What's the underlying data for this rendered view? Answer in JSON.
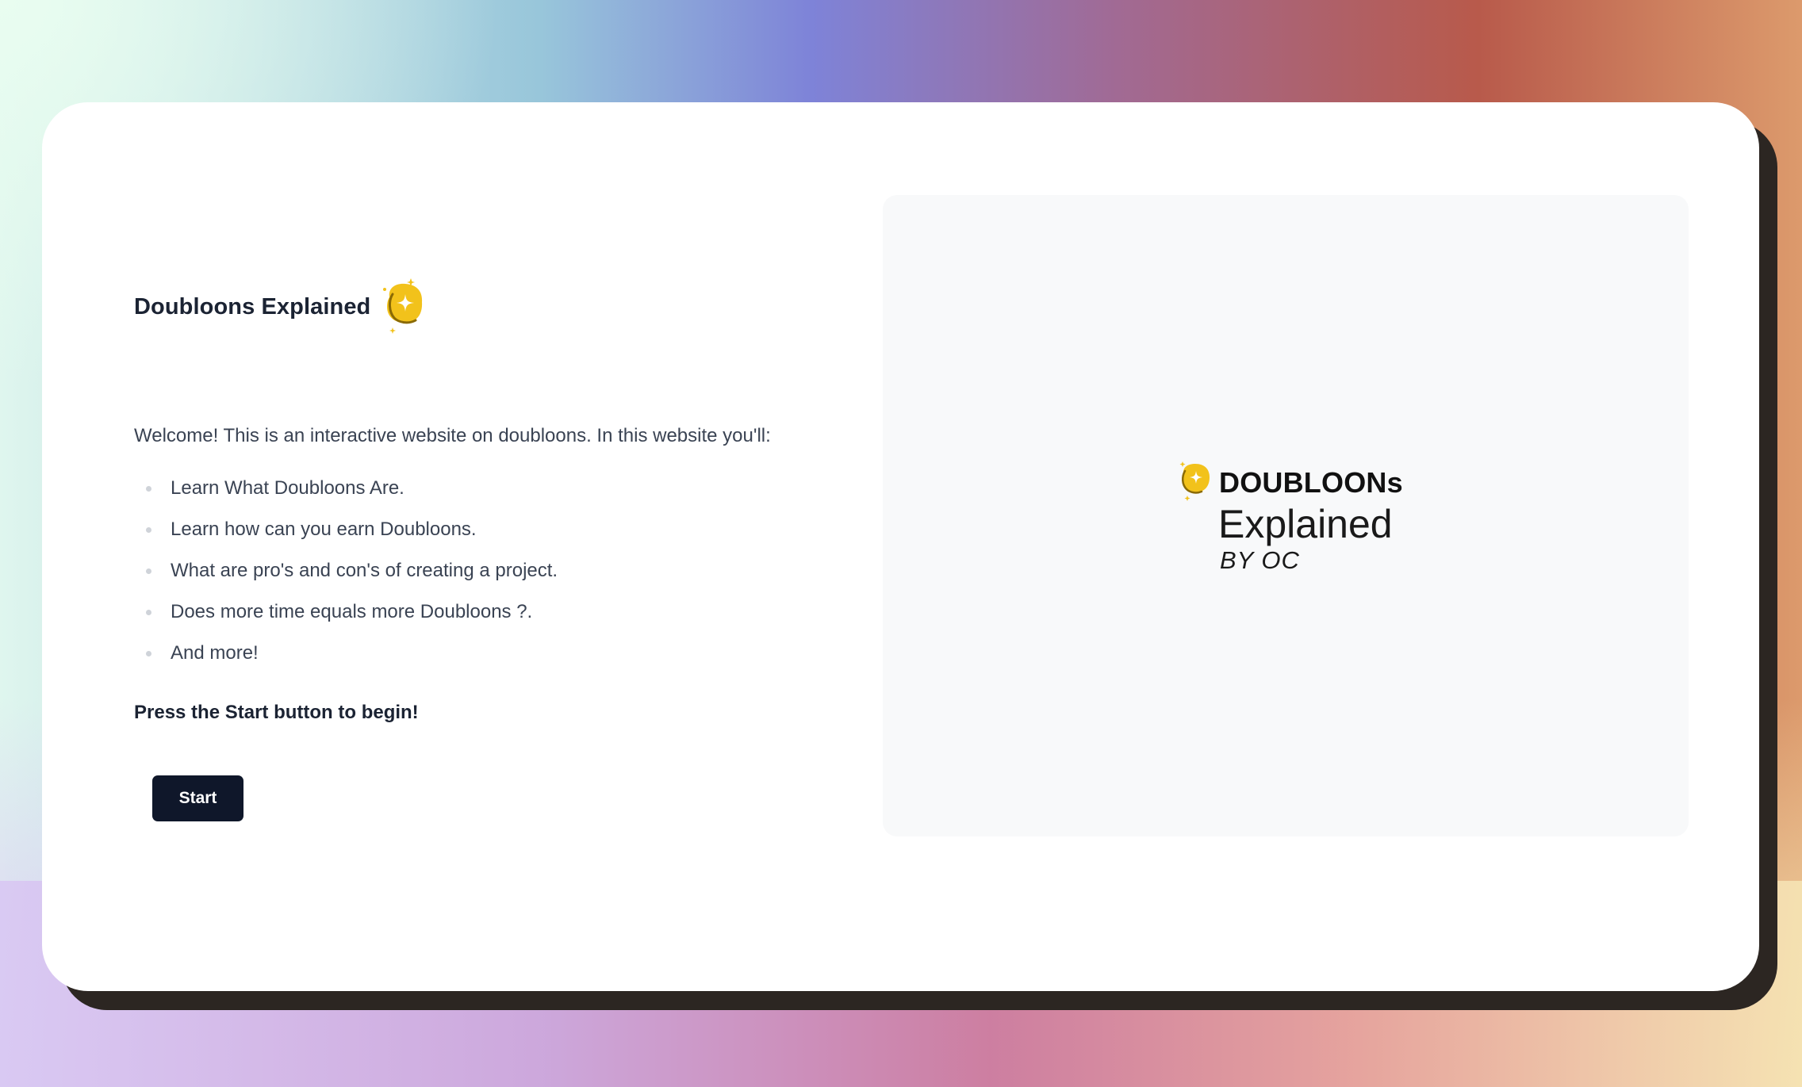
{
  "page": {
    "title": "Doubloons Explained",
    "title_icon": "doubloon-coin-icon",
    "welcome": "Welcome! This is an interactive website on doubloons. In this website you'll:",
    "features": [
      "Learn What Doubloons Are.",
      "Learn how can you earn Doubloons.",
      "What are pro's and con's of creating a project.",
      "Does more time equals more Doubloons ?.",
      "And more!"
    ],
    "prompt": "Press the Start button to begin!",
    "start_label": "Start"
  },
  "hero": {
    "logo_icon": "doubloon-coin-icon",
    "logo_word": "DOUBLOONs",
    "logo_sub": "Explained",
    "logo_by": "BY OC"
  },
  "colors": {
    "coin": "#f2c21b",
    "button": "#0f172a",
    "hero_bg": "#f8f9fa"
  }
}
